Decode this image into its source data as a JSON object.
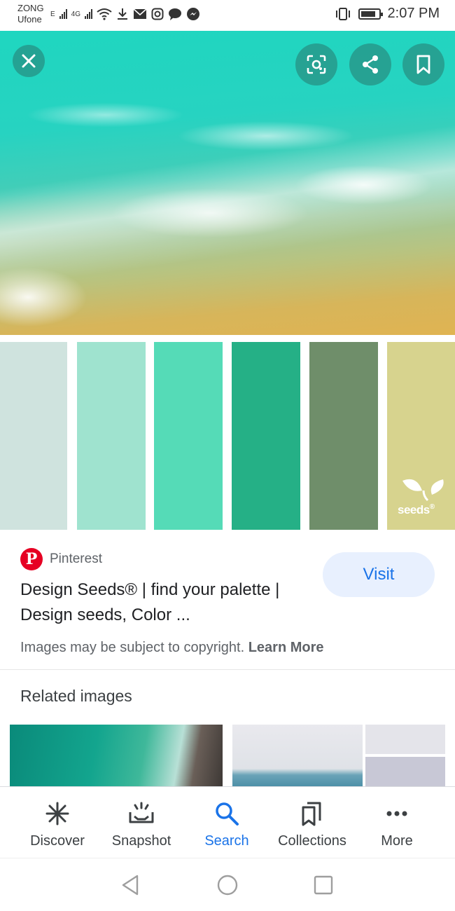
{
  "status_bar": {
    "carrier_1": "ZONG",
    "carrier_2": "Ufone",
    "network_1": "E",
    "network_2": "4G",
    "time": "2:07 PM"
  },
  "hero_actions": {
    "close_icon": "close-icon",
    "lens_icon": "lens-icon",
    "share_icon": "share-icon",
    "save_icon": "bookmark-icon"
  },
  "palette": {
    "swatches": [
      "#cfe3de",
      "#9fe3cf",
      "#55dbb7",
      "#25b086",
      "#6f8e6a",
      "#d7d38e"
    ],
    "brand": "seeds",
    "brand_suffix": "®"
  },
  "result": {
    "source": "Pinterest",
    "source_logo": "P",
    "title": "Design Seeds® | find your palette | Design seeds, Color ...",
    "visit_label": "Visit",
    "copyright_text": "Images may be subject to copyright.",
    "learn_more": "Learn More"
  },
  "related": {
    "heading": "Related images"
  },
  "bottom_nav": {
    "items": [
      {
        "label": "Discover",
        "icon": "asterisk-icon"
      },
      {
        "label": "Snapshot",
        "icon": "snapshot-icon"
      },
      {
        "label": "Search",
        "icon": "search-icon"
      },
      {
        "label": "Collections",
        "icon": "collections-icon"
      },
      {
        "label": "More",
        "icon": "more-dots-icon"
      }
    ],
    "active": "Search"
  },
  "colors": {
    "accent": "#1a73e8",
    "visit_bg": "#e8f0fe",
    "pinterest_red": "#e60023"
  }
}
